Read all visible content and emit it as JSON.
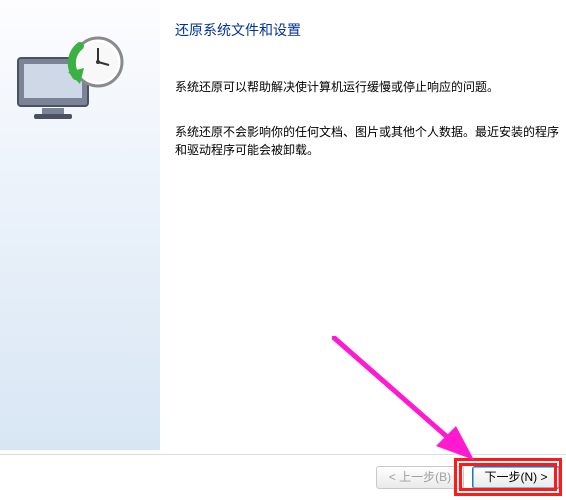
{
  "page": {
    "title": "还原系统文件和设置",
    "paragraph1": "系统还原可以帮助解决使计算机运行缓慢或停止响应的问题。",
    "paragraph2": "系统还原不会影响你的任何文档、图片或其他个人数据。最近安装的程序和驱动程序可能会被卸载。"
  },
  "buttons": {
    "back": "< 上一步(B)",
    "next": "下一步(N) >"
  },
  "icons": {
    "restore": "system-restore-icon",
    "pointer": "pointer-arrow"
  }
}
